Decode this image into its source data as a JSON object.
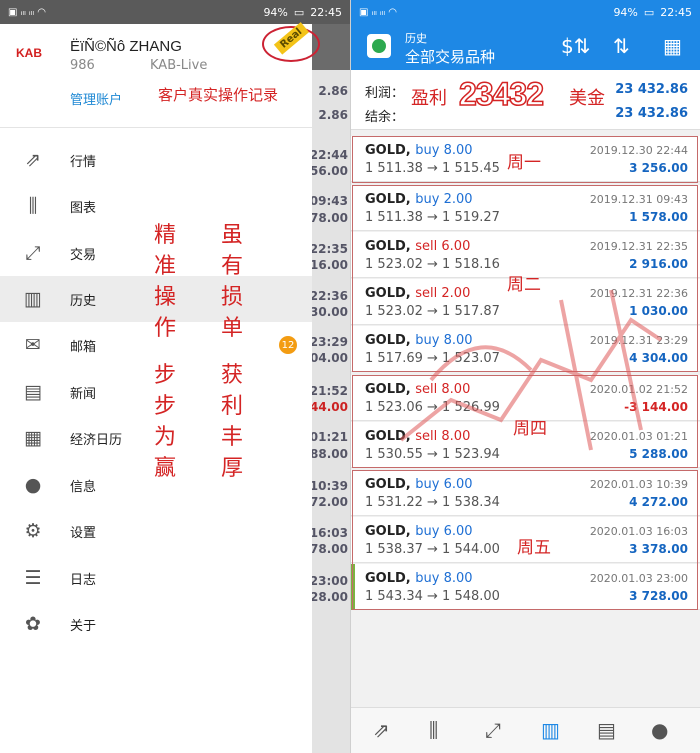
{
  "status": {
    "battery": "94%",
    "time": "22:45"
  },
  "left_under": {
    "values": [
      "2.86",
      "2.86",
      "22:44",
      "56.00",
      "09:43",
      "78.00",
      "22:35",
      "16.00",
      "22:36",
      "30.00",
      "23:29",
      "04.00",
      "21:52",
      "44.00",
      "01:21",
      "88.00",
      "10:39",
      "72.00",
      "16:03",
      "78.00",
      "23:00",
      "28.00"
    ]
  },
  "drawer": {
    "logo": "KAB",
    "account_name": "ËïÑ©Ñô ZHANG",
    "account_number": "986",
    "server": "KAB-Live",
    "manage_label": "管理账户",
    "real_badge": "Real",
    "note": "客户真实操作记录",
    "items": [
      {
        "label": "行情",
        "icon": "quotes-icon"
      },
      {
        "label": "图表",
        "icon": "chart-icon"
      },
      {
        "label": "交易",
        "icon": "trade-icon"
      },
      {
        "label": "历史",
        "icon": "history-icon"
      },
      {
        "label": "邮箱",
        "icon": "mail-icon",
        "badge": "12"
      },
      {
        "label": "新闻",
        "icon": "news-icon"
      },
      {
        "label": "经济日历",
        "icon": "calendar-icon"
      },
      {
        "label": "信息",
        "icon": "chat-icon"
      },
      {
        "label": "设置",
        "icon": "settings-icon"
      },
      {
        "label": "日志",
        "icon": "journal-icon"
      },
      {
        "label": "关于",
        "icon": "about-icon"
      }
    ],
    "vertical_notes": {
      "col1": [
        "精",
        "准",
        "操",
        "作"
      ],
      "col2": [
        "虽",
        "有",
        "损",
        "单"
      ],
      "col3": [
        "步",
        "步",
        "为",
        "赢"
      ],
      "col4": [
        "获",
        "利",
        "丰",
        "厚"
      ]
    }
  },
  "history": {
    "title_small": "历史",
    "title": "全部交易品种",
    "profit_label": "利润：",
    "profit_value": "23 432.86",
    "balance_label": "结余：",
    "balance_value": "23 432.86",
    "profit_note_prefix": "盈利",
    "profit_note_number": "23432",
    "profit_note_unit": "美金",
    "deals": [
      {
        "symbol": "GOLD,",
        "side": "buy",
        "volume": "buy 8.00",
        "prices": "1 511.38 → 1 515.45",
        "time": "2019.12.30 22:44",
        "pl": "3 256.00"
      },
      {
        "symbol": "GOLD,",
        "side": "buy",
        "volume": "buy 2.00",
        "prices": "1 511.38 → 1 519.27",
        "time": "2019.12.31 09:43",
        "pl": "1 578.00"
      },
      {
        "symbol": "GOLD,",
        "side": "sell",
        "volume": "sell 6.00",
        "prices": "1 523.02 → 1 518.16",
        "time": "2019.12.31 22:35",
        "pl": "2 916.00"
      },
      {
        "symbol": "GOLD,",
        "side": "sell",
        "volume": "sell 2.00",
        "prices": "1 523.02 → 1 517.87",
        "time": "2019.12.31 22:36",
        "pl": "1 030.00"
      },
      {
        "symbol": "GOLD,",
        "side": "buy",
        "volume": "buy 8.00",
        "prices": "1 517.69 → 1 523.07",
        "time": "2019.12.31 23:29",
        "pl": "4 304.00"
      },
      {
        "symbol": "GOLD,",
        "side": "sell",
        "volume": "sell 8.00",
        "prices": "1 523.06 → 1 526.99",
        "time": "2020.01.02 21:52",
        "pl": "-3 144.00"
      },
      {
        "symbol": "GOLD,",
        "side": "sell",
        "volume": "sell 8.00",
        "prices": "1 530.55 → 1 523.94",
        "time": "2020.01.03 01:21",
        "pl": "5 288.00"
      },
      {
        "symbol": "GOLD,",
        "side": "buy",
        "volume": "buy 6.00",
        "prices": "1 531.22 → 1 538.34",
        "time": "2020.01.03 10:39",
        "pl": "4 272.00"
      },
      {
        "symbol": "GOLD,",
        "side": "buy",
        "volume": "buy 6.00",
        "prices": "1 538.37 → 1 544.00",
        "time": "2020.01.03 16:03",
        "pl": "3 378.00"
      },
      {
        "symbol": "GOLD,",
        "side": "buy",
        "volume": "buy 8.00",
        "prices": "1 543.34 → 1 548.00",
        "time": "2020.01.03 23:00",
        "pl": "3 728.00"
      }
    ],
    "day_notes": [
      "周一",
      "周二",
      "周四",
      "周五"
    ]
  },
  "colors": {
    "accent": "#1e88e5",
    "buy": "#1e6fd4",
    "sell": "#d42424",
    "annotation": "#d42424"
  }
}
